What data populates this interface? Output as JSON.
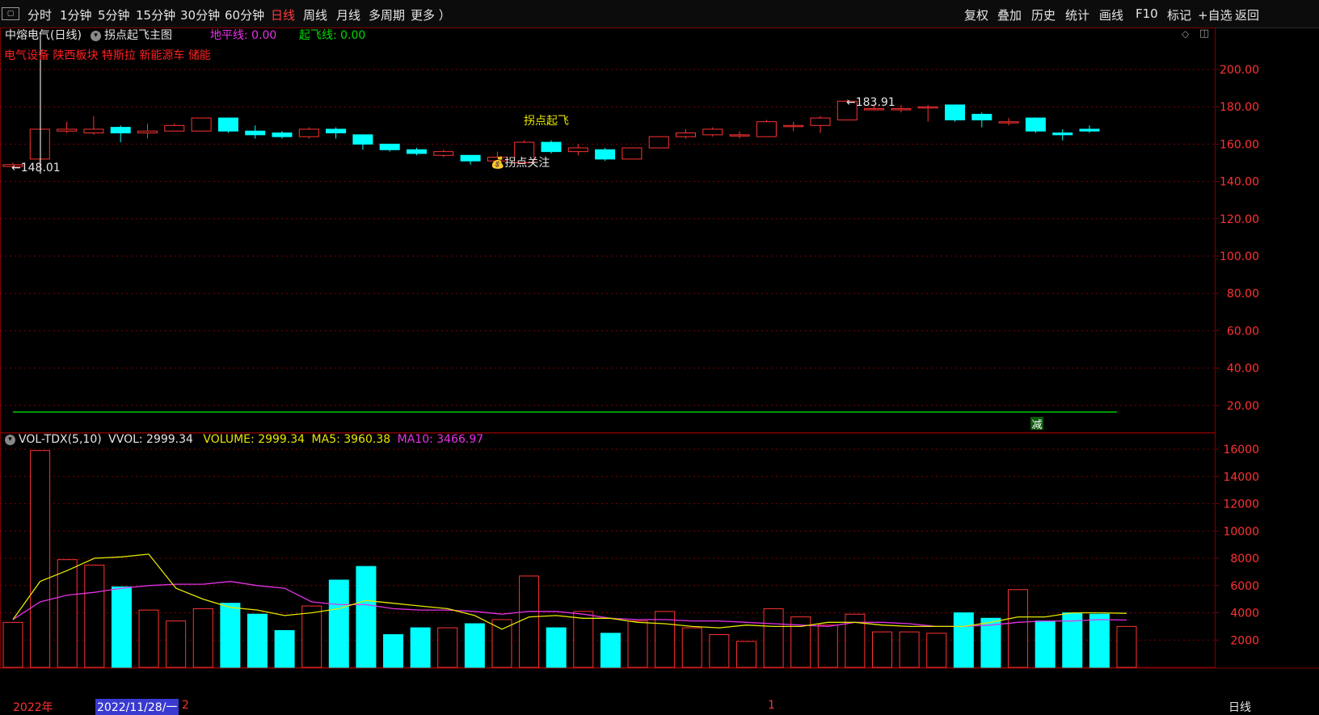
{
  "toolbar": {
    "periods": [
      "分时",
      "1分钟",
      "5分钟",
      "15分钟",
      "30分钟",
      "60分钟",
      "日线",
      "周线",
      "月线",
      "多周期",
      "更多 ）"
    ],
    "active_period": "日线",
    "tools": [
      "复权",
      "叠加",
      "历史",
      "统计",
      "画线",
      "F10",
      "标记",
      "+自选",
      "返回"
    ]
  },
  "header": {
    "stock": "中熔电气(日线)",
    "indicator": "拐点起飞主图",
    "dpx_label": "地平线: 0.00",
    "qfx_label": "起飞线: 0.00",
    "sectors": [
      "电气设备",
      "陕西板块",
      "特斯拉",
      "新能源车",
      "储能"
    ]
  },
  "vol_header": {
    "name": "VOL-TDX(5,10)",
    "vvol": "VVOL: 2999.34",
    "volume": "VOLUME: 2999.34",
    "ma5": "MA5: 3960.38",
    "ma10": "MA10: 3466.97"
  },
  "annotations": {
    "low": "←148.01",
    "high": "←183.91",
    "signal": "拐点起飞",
    "watch": "💰拐点关注",
    "reduce": "减"
  },
  "footer": {
    "year": "2022年",
    "date": "2022/11/28/一",
    "count": "2",
    "mid": "1",
    "period": "日线"
  },
  "colors": {
    "up": "#ff3232",
    "down": "#00ffff",
    "ma5": "#e6e600",
    "ma10": "#e632e6",
    "grid": "#800000",
    "green_line": "#00c800"
  },
  "chart_data": [
    {
      "type": "candlestick",
      "title": "中熔电气(日线)",
      "ylim": [
        0,
        210
      ],
      "yticks": [
        20,
        40,
        60,
        80,
        100,
        120,
        140,
        160,
        180,
        200
      ],
      "candles": [
        {
          "o": 148,
          "h": 150,
          "l": 147,
          "c": 149
        },
        {
          "o": 152,
          "h": 168,
          "l": 148,
          "c": 168
        },
        {
          "o": 167,
          "h": 172,
          "l": 166,
          "c": 168
        },
        {
          "o": 166,
          "h": 175,
          "l": 165,
          "c": 168
        },
        {
          "o": 169,
          "h": 170,
          "l": 161,
          "c": 166
        },
        {
          "o": 166,
          "h": 171,
          "l": 163,
          "c": 167
        },
        {
          "o": 167,
          "h": 171,
          "l": 167,
          "c": 170
        },
        {
          "o": 167,
          "h": 174,
          "l": 167,
          "c": 174
        },
        {
          "o": 174,
          "h": 174,
          "l": 166,
          "c": 167
        },
        {
          "o": 167,
          "h": 170,
          "l": 163,
          "c": 165
        },
        {
          "o": 166,
          "h": 167,
          "l": 163,
          "c": 164
        },
        {
          "o": 164,
          "h": 169,
          "l": 163,
          "c": 168
        },
        {
          "o": 168,
          "h": 169,
          "l": 163,
          "c": 166
        },
        {
          "o": 165,
          "h": 165,
          "l": 157,
          "c": 160
        },
        {
          "o": 160,
          "h": 160,
          "l": 156,
          "c": 157
        },
        {
          "o": 157,
          "h": 158,
          "l": 154,
          "c": 155
        },
        {
          "o": 154,
          "h": 157,
          "l": 153,
          "c": 156
        },
        {
          "o": 154,
          "h": 154,
          "l": 149,
          "c": 151
        },
        {
          "o": 151,
          "h": 156,
          "l": 148,
          "c": 153
        },
        {
          "o": 150,
          "h": 162,
          "l": 150,
          "c": 161
        },
        {
          "o": 161,
          "h": 162,
          "l": 155,
          "c": 156
        },
        {
          "o": 156,
          "h": 160,
          "l": 154,
          "c": 158
        },
        {
          "o": 157,
          "h": 158,
          "l": 151,
          "c": 152
        },
        {
          "o": 152,
          "h": 158,
          "l": 152,
          "c": 158
        },
        {
          "o": 158,
          "h": 164,
          "l": 158,
          "c": 164
        },
        {
          "o": 164,
          "h": 168,
          "l": 163,
          "c": 166
        },
        {
          "o": 165,
          "h": 169,
          "l": 164,
          "c": 168
        },
        {
          "o": 165,
          "h": 167,
          "l": 163,
          "c": 165
        },
        {
          "o": 164,
          "h": 173,
          "l": 164,
          "c": 172
        },
        {
          "o": 170,
          "h": 172,
          "l": 167,
          "c": 170
        },
        {
          "o": 170,
          "h": 175,
          "l": 166,
          "c": 174
        },
        {
          "o": 173,
          "h": 184,
          "l": 173,
          "c": 183
        },
        {
          "o": 179,
          "h": 181,
          "l": 178,
          "c": 179
        },
        {
          "o": 179,
          "h": 181,
          "l": 177,
          "c": 179
        },
        {
          "o": 180,
          "h": 181,
          "l": 172,
          "c": 180
        },
        {
          "o": 181,
          "h": 181,
          "l": 172,
          "c": 173
        },
        {
          "o": 176,
          "h": 177,
          "l": 169,
          "c": 173
        },
        {
          "o": 172,
          "h": 174,
          "l": 170,
          "c": 172
        },
        {
          "o": 174,
          "h": 174,
          "l": 166,
          "c": 167
        },
        {
          "o": 166,
          "h": 168,
          "l": 162,
          "c": 165
        },
        {
          "o": 168,
          "h": 170,
          "l": 166,
          "c": 167
        }
      ]
    },
    {
      "type": "bar",
      "title": "VOL-TDX(5,10)",
      "ylim": [
        0,
        17000
      ],
      "yticks": [
        2000,
        4000,
        6000,
        8000,
        10000,
        12000,
        14000,
        16000
      ],
      "volumes": [
        3300,
        15900,
        7900,
        7500,
        5900,
        4200,
        3400,
        4300,
        4700,
        3900,
        2700,
        4500,
        6400,
        7400,
        2400,
        2900,
        2900,
        3200,
        3500,
        6700,
        2900,
        4100,
        2500,
        3400,
        4100,
        2900,
        2400,
        1900,
        4300,
        3700,
        3100,
        3900,
        2600,
        2600,
        2500,
        4000,
        3600,
        5700,
        3400,
        4000,
        3900,
        3000
      ],
      "ma5": [
        3500,
        6300,
        7100,
        8000,
        8100,
        8300,
        5800,
        5000,
        4400,
        4200,
        3800,
        4000,
        4300,
        4900,
        4700,
        4500,
        4300,
        3800,
        2800,
        3700,
        3800,
        3600,
        3600,
        3300,
        3200,
        3000,
        2900,
        3100,
        3000,
        3000,
        3300,
        3300,
        3100,
        3000,
        3000,
        3000,
        3300,
        3700,
        3700,
        4000,
        4000,
        3960
      ],
      "ma10": [
        3500,
        4800,
        5300,
        5500,
        5800,
        6000,
        6100,
        6100,
        6300,
        6000,
        5800,
        4800,
        4600,
        4600,
        4300,
        4200,
        4200,
        4100,
        3900,
        4100,
        4100,
        3900,
        3600,
        3500,
        3500,
        3400,
        3400,
        3300,
        3200,
        3100,
        3000,
        3300,
        3300,
        3200,
        3000,
        3000,
        3100,
        3300,
        3400,
        3400,
        3500,
        3467
      ]
    }
  ]
}
